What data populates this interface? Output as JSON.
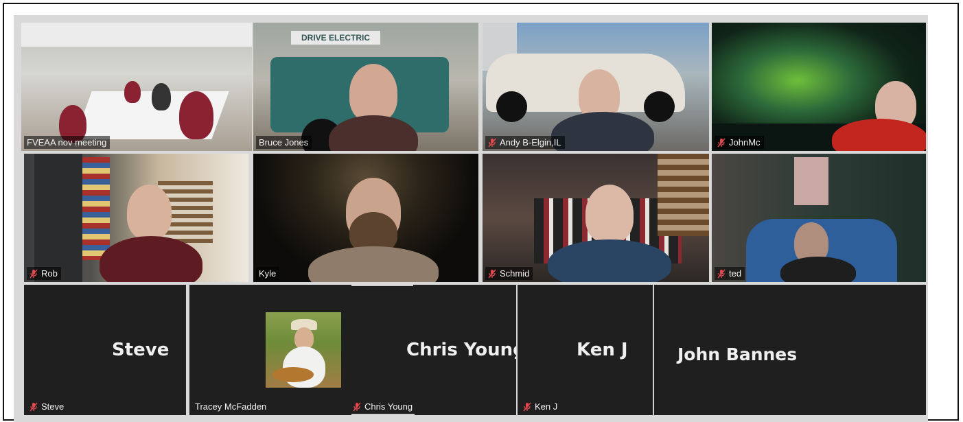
{
  "participants": {
    "p1": {
      "name": "FVEAA nov meeting",
      "muted": false
    },
    "p2": {
      "name": "Bruce Jones",
      "muted": false,
      "sign": "DRIVE ELECTRIC"
    },
    "p3": {
      "name": "Andy B-Elgin,IL",
      "muted": true
    },
    "p4": {
      "name": "JohnMc",
      "muted": true
    },
    "p5": {
      "name": "Rob",
      "muted": true
    },
    "p6": {
      "name": "Kyle",
      "muted": false
    },
    "p7": {
      "name": "Schmid",
      "muted": true
    },
    "p8": {
      "name": "ted",
      "muted": true
    },
    "p9": {
      "name": "Steve",
      "display": "Steve",
      "muted": true
    },
    "p10": {
      "name": "Tracey McFadden",
      "muted": false
    },
    "p11": {
      "name": "Chris Young",
      "display": "Chris Young",
      "muted": true
    },
    "p12": {
      "name": "Ken J",
      "display": "Ken J",
      "muted": true
    },
    "p13": {
      "display": "John Bannes"
    }
  },
  "colors": {
    "tile_bg": "#1f1f1f",
    "active_speaker": "#b6c94b",
    "mute_icon": "#e5484d"
  }
}
